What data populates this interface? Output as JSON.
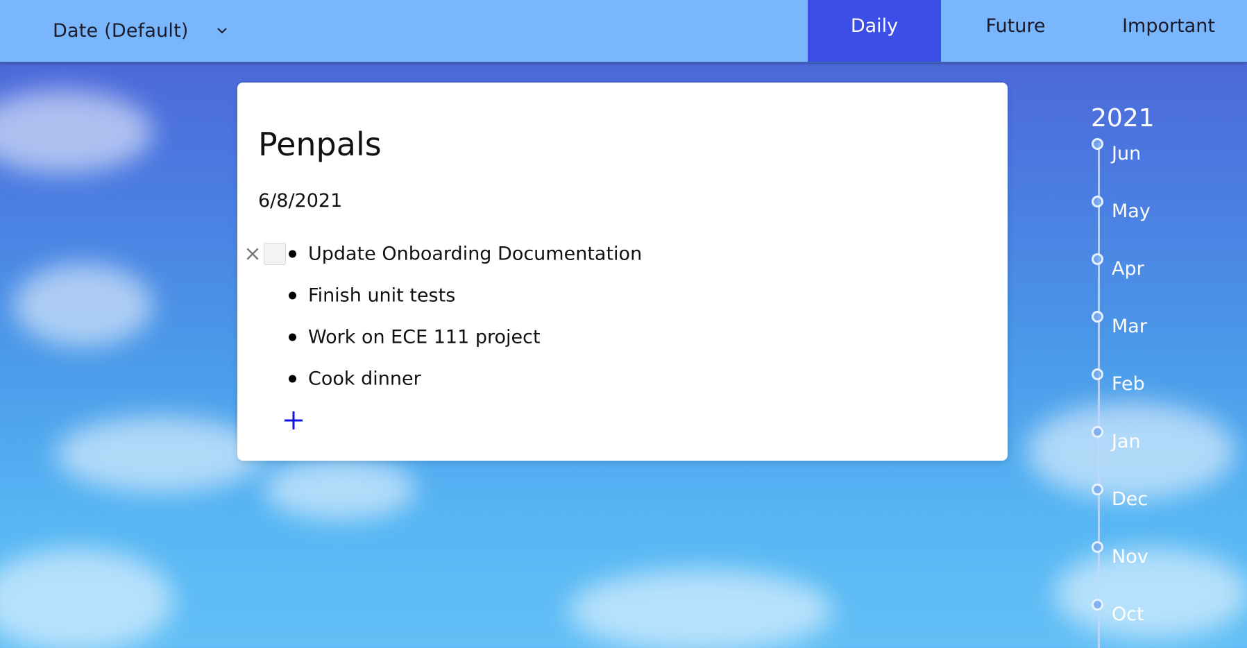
{
  "toolbar": {
    "sort_label": "Date (Default)",
    "tabs": [
      {
        "label": "Daily",
        "active": true
      },
      {
        "label": "Future",
        "active": false
      },
      {
        "label": "Important",
        "active": false
      }
    ]
  },
  "card": {
    "title": "Penpals",
    "date": "6/8/2021",
    "tasks": [
      {
        "text": "Update Onboarding Documentation",
        "checked": false
      },
      {
        "text": "Finish unit tests",
        "checked": false
      },
      {
        "text": "Work on ECE 111 project",
        "checked": false
      },
      {
        "text": "Cook dinner",
        "checked": false
      }
    ],
    "add_icon": "plus-icon"
  },
  "timeline": {
    "year": "2021",
    "months": [
      "Jun",
      "May",
      "Apr",
      "Mar",
      "Feb",
      "Jan",
      "Dec",
      "Nov",
      "Oct"
    ]
  },
  "colors": {
    "topbar": "#79b6fb",
    "active_tab": "#3b4fe6",
    "add_icon": "#1010e0"
  }
}
